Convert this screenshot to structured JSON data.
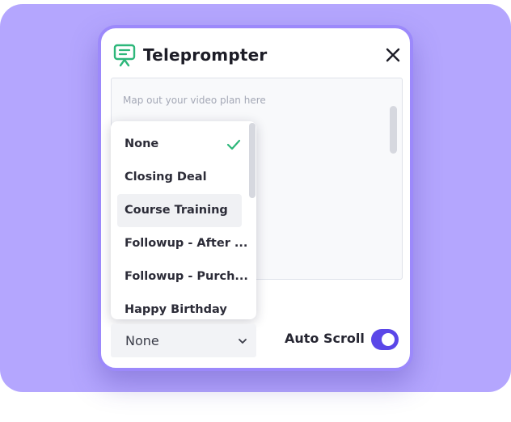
{
  "colors": {
    "backdrop": "#b4a6fe",
    "accent": "#5b47e8",
    "icon_green": "#2db77a"
  },
  "header": {
    "title": "Teleprompter",
    "icon": "teleprompter-icon",
    "close_icon": "close-icon"
  },
  "editor": {
    "placeholder": "Map out your video plan here"
  },
  "dropdown": {
    "selected": "None",
    "items": [
      {
        "label": "None",
        "checked": true
      },
      {
        "label": "Closing Deal"
      },
      {
        "label": "Course Training",
        "hovered": true
      },
      {
        "label": "Followup - After ..."
      },
      {
        "label": "Followup - Purch..."
      },
      {
        "label": "Happy Birthday"
      }
    ]
  },
  "footer": {
    "select_value": "None",
    "auto_scroll_label": "Auto Scroll",
    "auto_scroll_on": true
  }
}
